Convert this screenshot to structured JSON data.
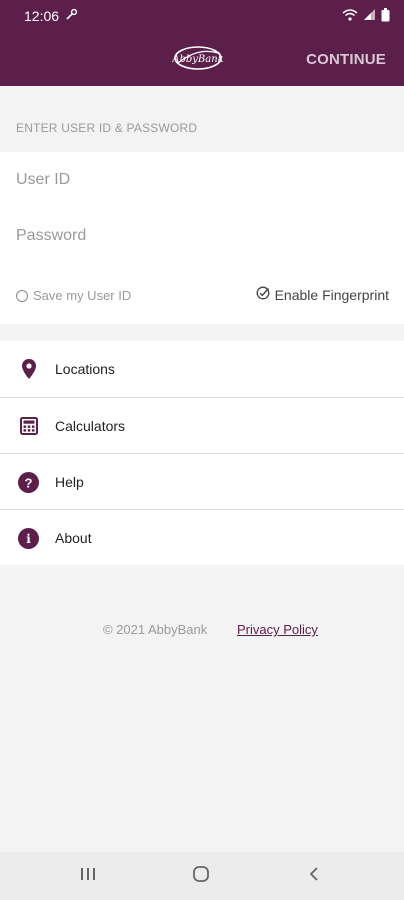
{
  "status_bar": {
    "time": "12:06",
    "left_icon": "wrench-icon",
    "right_icons": [
      "wifi-icon",
      "signal-icon",
      "battery-icon"
    ]
  },
  "header": {
    "logo_text": "AbbyBank",
    "continue_label": "CONTINUE",
    "background_color": "#5c1f4b"
  },
  "login": {
    "section_label": "ENTER USER ID & PASSWORD",
    "user_id_placeholder": "User ID",
    "password_placeholder": "Password",
    "save_user_id_label": "Save my User ID",
    "enable_fingerprint_label": "Enable Fingerprint"
  },
  "menu": {
    "items": [
      {
        "label": "Locations",
        "icon": "location-pin-icon"
      },
      {
        "label": "Calculators",
        "icon": "calculator-icon"
      },
      {
        "label": "Help",
        "icon": "help-icon"
      },
      {
        "label": "About",
        "icon": "info-icon"
      }
    ]
  },
  "footer": {
    "copyright": "© 2021 AbbyBank",
    "privacy_link": "Privacy Policy"
  },
  "nav_bar": {
    "buttons": [
      "recent-apps-icon",
      "home-icon",
      "back-icon"
    ]
  }
}
